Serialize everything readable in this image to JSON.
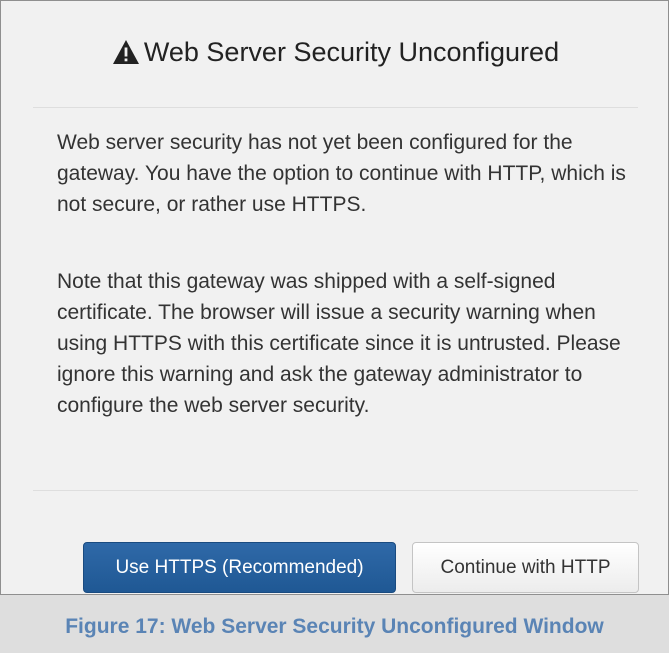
{
  "dialog": {
    "title": "Web Server Security Unconfigured",
    "title_icon": "warning-triangle-icon",
    "paragraph_1": "Web server security has not yet been configured for the gateway. You have the option to continue with HTTP, which is not secure, or rather use HTTPS.",
    "paragraph_2": "Note that this gateway was shipped with a self-signed certificate. The browser will issue a security warning when using HTTPS with this certificate since it is untrusted. Please ignore this warning and ask the gateway administrator to configure the web server security.",
    "buttons": {
      "primary_label": "Use HTTPS (Recommended)",
      "secondary_label": "Continue with HTTP"
    }
  },
  "caption": {
    "text": "Figure 17: Web Server Security Unconfigured Window"
  },
  "colors": {
    "primary_button": "#2a64a3",
    "caption_text": "#5a84b5",
    "dialog_background": "#f1f1f1"
  }
}
